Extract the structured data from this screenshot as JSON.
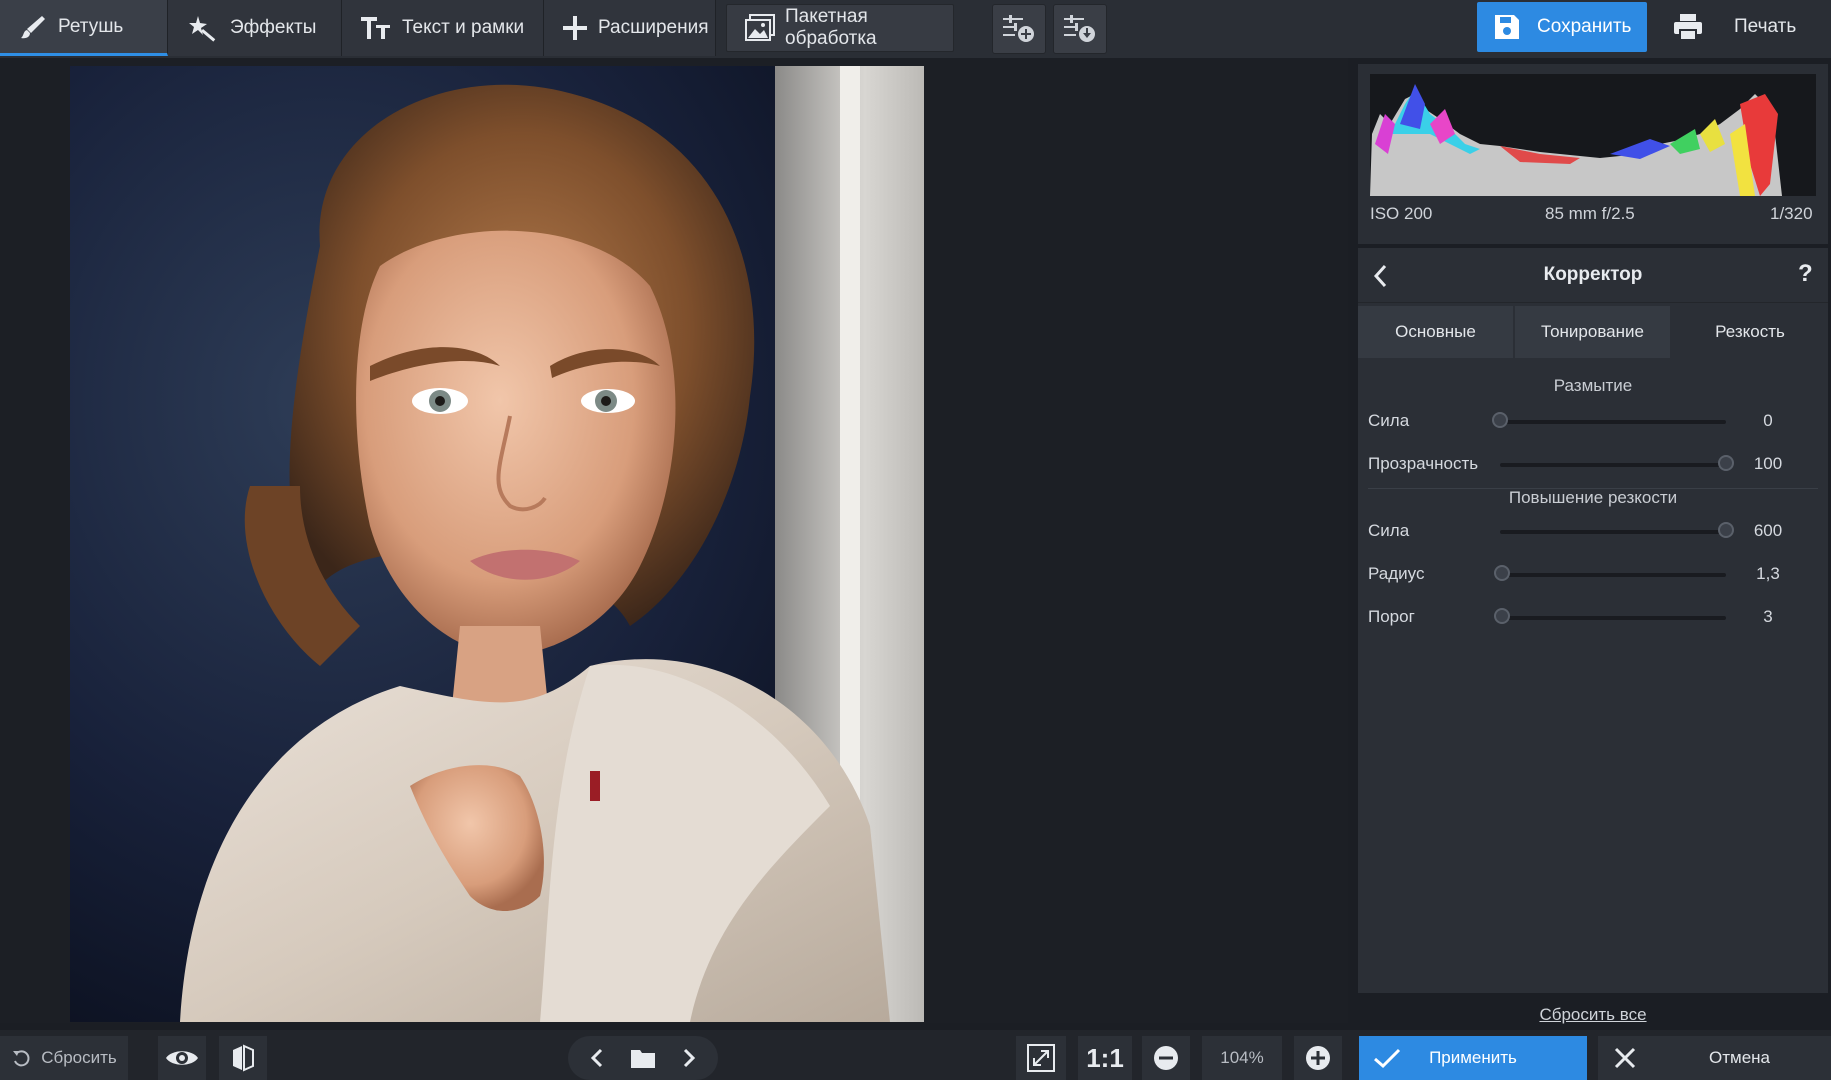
{
  "toolbar": {
    "tabs": [
      {
        "label": "Ретушь",
        "icon": "brush-icon"
      },
      {
        "label": "Эффекты",
        "icon": "magic-wand-icon"
      },
      {
        "label": "Текст и рамки",
        "icon": "text-icon"
      },
      {
        "label": "Расширения",
        "icon": "plus-icon"
      },
      {
        "label": "Пакетная обработка",
        "icon": "images-icon"
      }
    ],
    "active_tab": "Ретушь",
    "save_label": "Сохранить",
    "print_label": "Печать"
  },
  "histogram": {
    "iso": "ISO 200",
    "lens": "85 mm f/2.5",
    "shutter": "1/320"
  },
  "corrector": {
    "title": "Корректор",
    "help": "?",
    "tabs": [
      "Основные",
      "Тонирование",
      "Резкость"
    ],
    "active_tab": "Резкость",
    "blur": {
      "title": "Размытие",
      "strength": {
        "label": "Сила",
        "value": "0",
        "fraction": 0.0
      },
      "opacity": {
        "label": "Прозрачность",
        "value": "100",
        "fraction": 1.0
      }
    },
    "sharpen": {
      "title": "Повышение резкости",
      "strength": {
        "label": "Сила",
        "value": "600",
        "fraction": 1.0
      },
      "radius": {
        "label": "Радиус",
        "value": "1,3",
        "fraction": 0.01
      },
      "threshold": {
        "label": "Порог",
        "value": "3",
        "fraction": 0.01
      }
    },
    "reset_all": "Сбросить все"
  },
  "bottombar": {
    "reset_label": "Сбросить",
    "fit_label": "1:1",
    "zoom": "104%",
    "apply_label": "Применить",
    "cancel_label": "Отмена"
  },
  "colors": {
    "accent": "#2d8ae2",
    "panel": "#2b2f36",
    "background": "#1b1e24"
  }
}
